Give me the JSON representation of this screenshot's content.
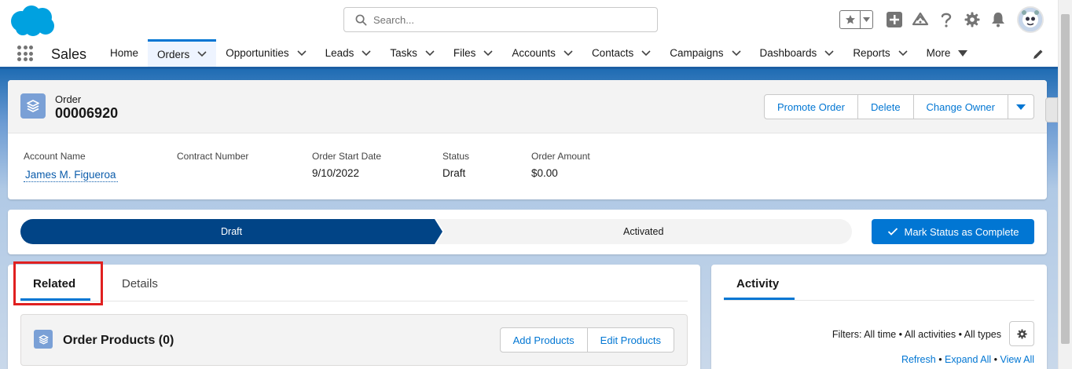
{
  "header": {
    "search_placeholder": "Search...",
    "icons": [
      "favorites-star-icon",
      "add-icon",
      "trailhead-icon",
      "help-icon",
      "setup-gear-icon",
      "notifications-bell-icon",
      "user-avatar"
    ]
  },
  "nav": {
    "app_name": "Sales",
    "items": [
      {
        "label": "Home",
        "dropdown": false,
        "active": false
      },
      {
        "label": "Orders",
        "dropdown": true,
        "active": true
      },
      {
        "label": "Opportunities",
        "dropdown": true,
        "active": false
      },
      {
        "label": "Leads",
        "dropdown": true,
        "active": false
      },
      {
        "label": "Tasks",
        "dropdown": true,
        "active": false
      },
      {
        "label": "Files",
        "dropdown": true,
        "active": false
      },
      {
        "label": "Accounts",
        "dropdown": true,
        "active": false
      },
      {
        "label": "Contacts",
        "dropdown": true,
        "active": false
      },
      {
        "label": "Campaigns",
        "dropdown": true,
        "active": false
      },
      {
        "label": "Dashboards",
        "dropdown": true,
        "active": false
      },
      {
        "label": "Reports",
        "dropdown": true,
        "active": false
      },
      {
        "label": "More",
        "dropdown": true,
        "active": false
      }
    ]
  },
  "record": {
    "type": "Order",
    "number": "00006920",
    "actions": [
      "Promote Order",
      "Delete",
      "Change Owner"
    ],
    "fields": [
      {
        "label": "Account Name",
        "value": "James M. Figueroa",
        "link": true
      },
      {
        "label": "Contract Number",
        "value": "",
        "link": false
      },
      {
        "label": "Order Start Date",
        "value": "9/10/2022",
        "link": false
      },
      {
        "label": "Status",
        "value": "Draft",
        "link": false
      },
      {
        "label": "Order Amount",
        "value": "$0.00",
        "link": false
      }
    ]
  },
  "path": {
    "stages": [
      "Draft",
      "Activated"
    ],
    "current": "Draft",
    "mark_button": "Mark Status as Complete"
  },
  "related": {
    "tabs": [
      "Related",
      "Details"
    ],
    "active_tab": "Related",
    "order_products_title": "Order Products (0)",
    "buttons": [
      "Add Products",
      "Edit Products"
    ]
  },
  "activity": {
    "tab": "Activity",
    "filters": "Filters: All time • All activities • All types",
    "links": [
      "Refresh",
      "Expand All",
      "View All"
    ]
  },
  "colors": {
    "brand_blue": "#0176d3",
    "path_active": "#014486",
    "highlight_red": "#e02020"
  }
}
